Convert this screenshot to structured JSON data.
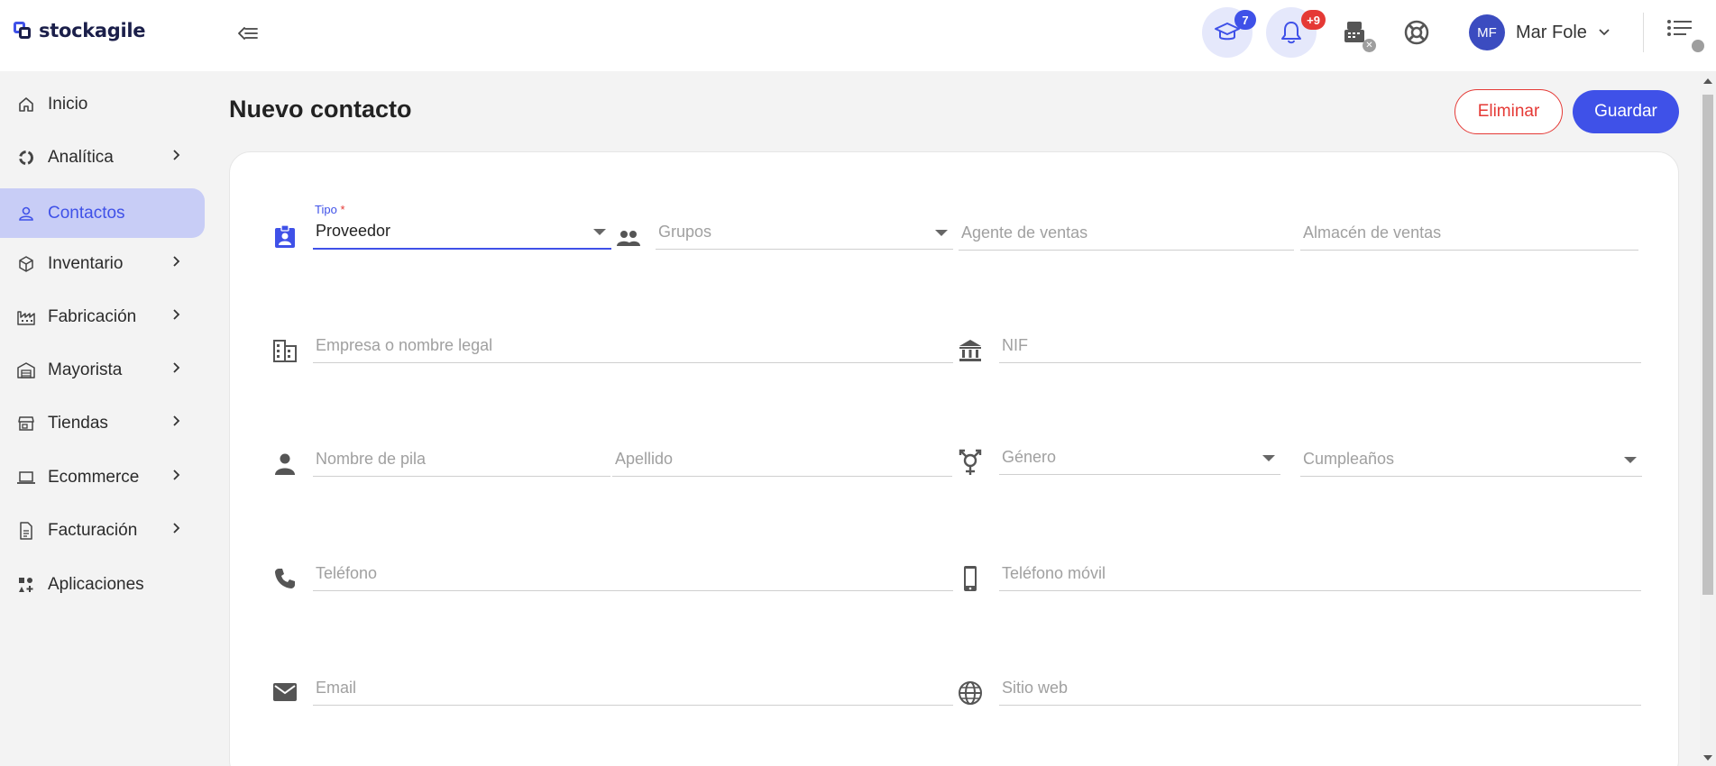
{
  "app": {
    "logo_text": "stockagile",
    "accent": "#3f51e8",
    "danger": "#e53935"
  },
  "topbar": {
    "academy_badge": "7",
    "notifications_badge": "+9",
    "user": {
      "initials": "MF",
      "name": "Mar Fole"
    }
  },
  "sidebar": {
    "items": [
      {
        "label": "Inicio",
        "icon": "home-icon",
        "has_submenu": false,
        "active": false
      },
      {
        "label": "Analítica",
        "icon": "analytics-icon",
        "has_submenu": true,
        "active": false
      },
      {
        "label": "Contactos",
        "icon": "person-icon",
        "has_submenu": false,
        "active": true
      },
      {
        "label": "Inventario",
        "icon": "box-icon",
        "has_submenu": true,
        "active": false
      },
      {
        "label": "Fabricación",
        "icon": "factory-icon",
        "has_submenu": true,
        "active": false
      },
      {
        "label": "Mayorista",
        "icon": "warehouse-icon",
        "has_submenu": true,
        "active": false
      },
      {
        "label": "Tiendas",
        "icon": "store-icon",
        "has_submenu": true,
        "active": false
      },
      {
        "label": "Ecommerce",
        "icon": "laptop-icon",
        "has_submenu": true,
        "active": false
      },
      {
        "label": "Facturación",
        "icon": "document-icon",
        "has_submenu": true,
        "active": false
      },
      {
        "label": "Aplicaciones",
        "icon": "apps-icon",
        "has_submenu": false,
        "active": false
      }
    ]
  },
  "main": {
    "title": "Nuevo contacto",
    "delete_label": "Eliminar",
    "save_label": "Guardar"
  },
  "form": {
    "tipo": {
      "label": "Tipo",
      "required_mark": "*",
      "value": "Proveedor"
    },
    "grupos": {
      "placeholder": "Grupos"
    },
    "agente": {
      "placeholder": "Agente de ventas"
    },
    "almacen": {
      "placeholder": "Almacén de ventas"
    },
    "empresa": {
      "placeholder": "Empresa o nombre legal"
    },
    "nif": {
      "placeholder": "NIF"
    },
    "nombre": {
      "placeholder": "Nombre de pila"
    },
    "apellido": {
      "placeholder": "Apellido"
    },
    "genero": {
      "placeholder": "Género"
    },
    "cumpleanos": {
      "placeholder": "Cumpleaños"
    },
    "telefono": {
      "placeholder": "Teléfono"
    },
    "movil": {
      "placeholder": "Teléfono móvil"
    },
    "email": {
      "placeholder": "Email"
    },
    "web": {
      "placeholder": "Sitio web"
    }
  }
}
